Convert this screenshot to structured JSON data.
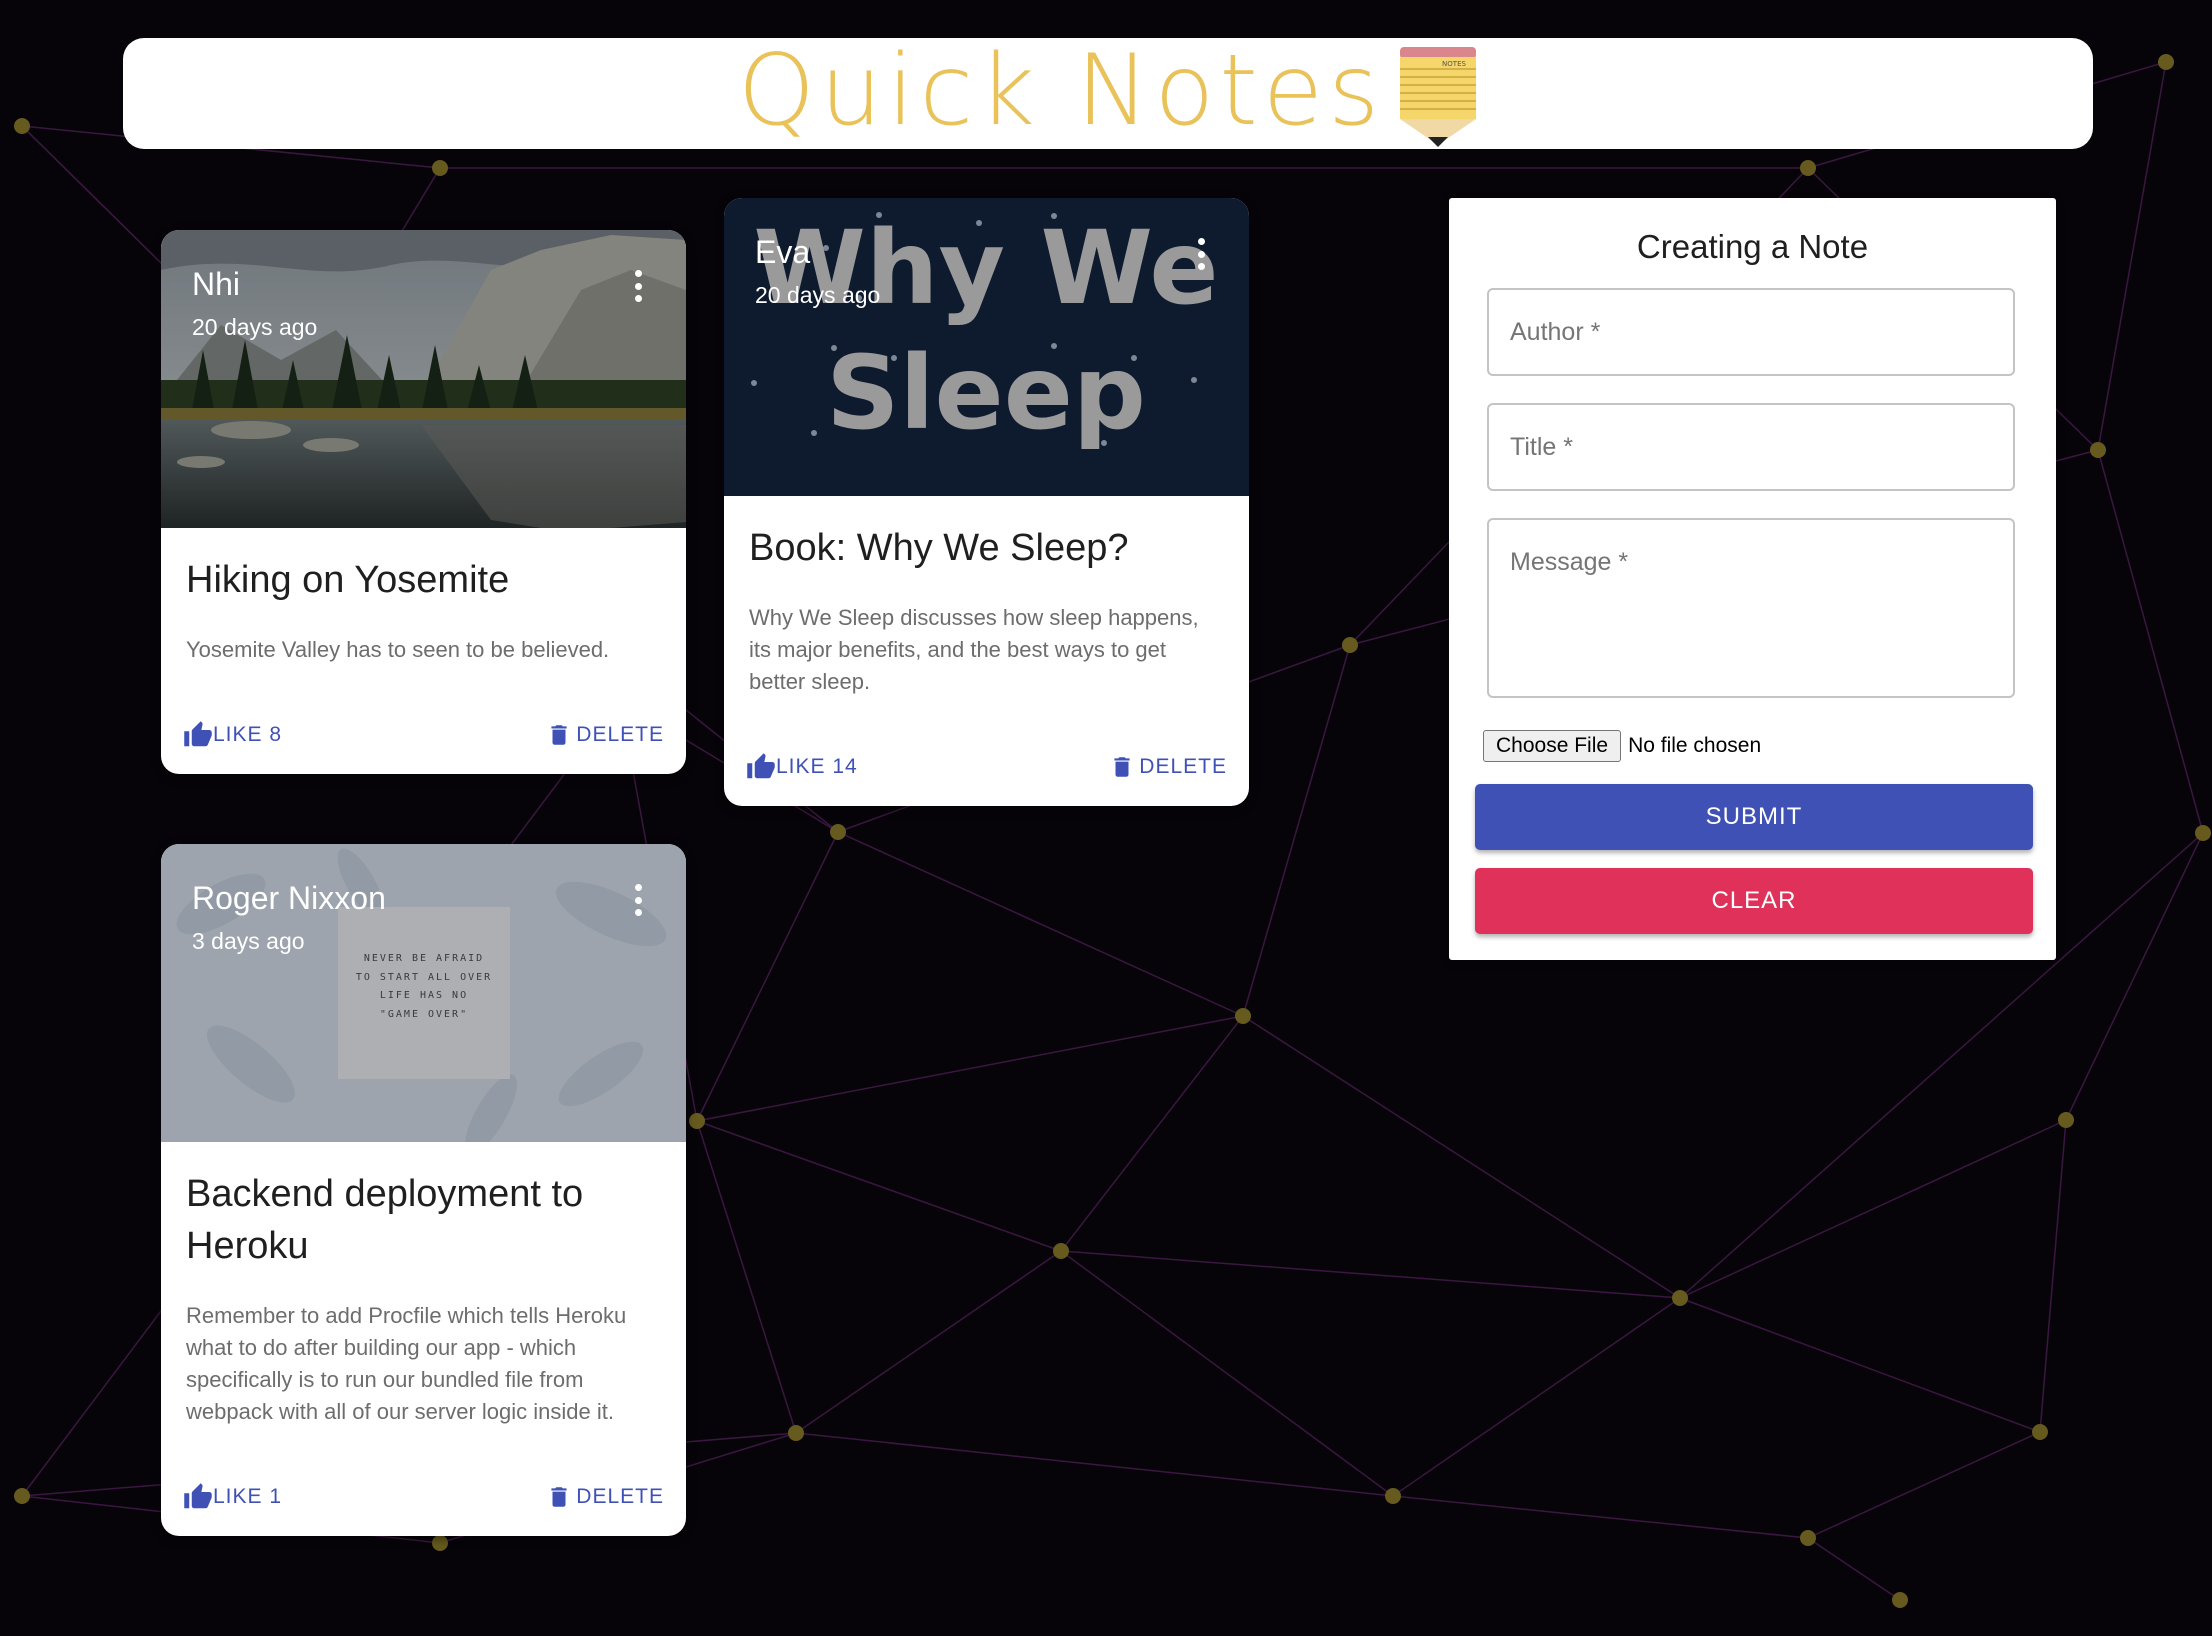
{
  "app": {
    "title": "Quick Notes",
    "logo_icon": "notes-pencil-icon",
    "logo_label": "NOTES"
  },
  "colors": {
    "background": "#070409",
    "network_line": "#3a1740",
    "network_node": "#665a1e",
    "title": "#e9c25a",
    "primary": "#3f51b5",
    "secondary": "#e0315a"
  },
  "posts": [
    {
      "author": "Nhi",
      "time": "20 days ago",
      "title": "Hiking on Yosemite",
      "message": "Yosemite Valley has to seen to be believed.",
      "like_label": "LIKE 8",
      "delete_label": "DELETE",
      "image": "mountain-lake-photo"
    },
    {
      "author": "Eva",
      "time": "20 days ago",
      "title": "Book: Why We Sleep?",
      "message": "Why We Sleep discusses how sleep happens, its major benefits, and the best ways to get better sleep.",
      "like_label": "LIKE 14",
      "delete_label": "DELETE",
      "image": "book-cover",
      "image_text_line1": "Why We",
      "image_text_line2": "Sleep"
    },
    {
      "author": "Roger Nixxon",
      "time": "3 days ago",
      "title": "Backend deployment to Heroku",
      "message": "Remember to add Procfile which tells Heroku what to do after building our app - which specifically is to run our bundled file from webpack with all of our server logic inside it.",
      "like_label": "LIKE 1",
      "delete_label": "DELETE",
      "image": "quote-poster",
      "quote_lines": [
        "NEVER BE AFRAID",
        "TO START ALL OVER",
        "LIFE HAS NO",
        "\"GAME OVER\""
      ]
    }
  ],
  "form": {
    "heading": "Creating a Note",
    "author_placeholder": "Author *",
    "title_placeholder": "Title *",
    "message_placeholder": "Message *",
    "file_button": "Choose File",
    "file_status": "No file chosen",
    "submit_label": "SUBMIT",
    "clear_label": "CLEAR"
  }
}
